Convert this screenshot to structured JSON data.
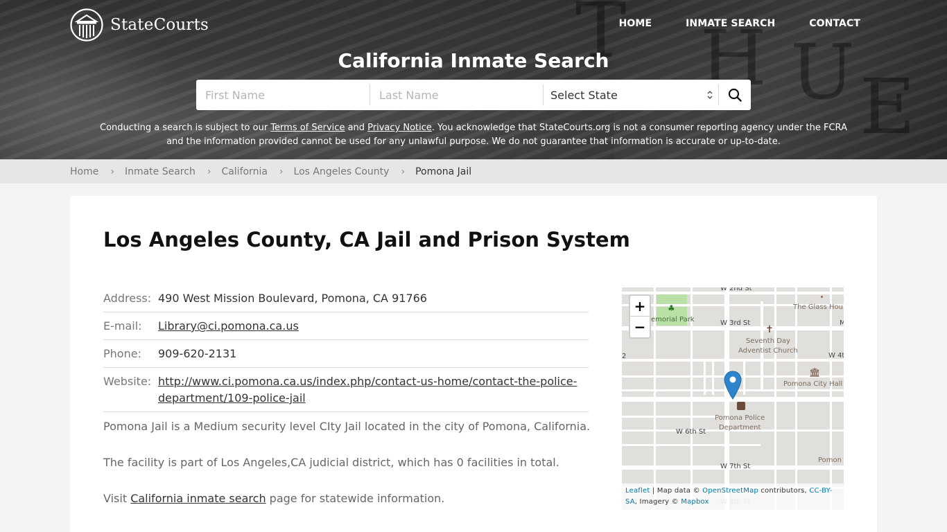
{
  "site": {
    "logo_text": "StateCourts",
    "nav": [
      {
        "label": "HOME"
      },
      {
        "label": "INMATE SEARCH"
      },
      {
        "label": "CONTACT"
      }
    ]
  },
  "hero": {
    "title": "California Inmate Search",
    "search": {
      "first_name_placeholder": "First Name",
      "last_name_placeholder": "Last Name",
      "state_select_value": "Select State",
      "search_icon": "search-icon"
    },
    "disclaimer": {
      "prefix": "Conducting a search is subject to our ",
      "terms_link": "Terms of Service",
      "and": " and ",
      "privacy_link": "Privacy Notice",
      "suffix": ". You acknowledge that StateCourts.org is not a consumer reporting agency under the FCRA and the information provided cannot be used for any unlawful purpose. We do not guarantee that information is accurate or up-to-date."
    }
  },
  "breadcrumb": [
    {
      "label": "Home"
    },
    {
      "label": "Inmate Search"
    },
    {
      "label": "California"
    },
    {
      "label": "Los Angeles County"
    },
    {
      "label": "Pomona Jail"
    }
  ],
  "main": {
    "title": "Los Angeles County, CA Jail and Prison System",
    "info": {
      "address_label": "Address:",
      "address_value": "490 West Mission Boulevard, Pomona, CA 91766",
      "email_label": "E-mail:",
      "email_value": "Library@ci.pomona.ca.us",
      "phone_label": "Phone:",
      "phone_value": "909-620-2131",
      "website_label": "Website:",
      "website_value": "http://www.ci.pomona.ca.us/index.php/contact-us-home/contact-the-police-department/109-police-jail"
    },
    "paragraphs": {
      "p1": "Pomona Jail is a Medium security level CIty Jail located in the city of Pomona, California.",
      "p2": "The facility is part of Los Angeles,CA judicial district, which has 0 facilities in total.",
      "p3_prefix": "Visit ",
      "p3_link": "California inmate search",
      "p3_suffix": " page for statewide information."
    }
  },
  "map": {
    "zoom_in": "+",
    "zoom_out": "−",
    "labels": {
      "w2nd": "W 2nd St",
      "w3rd": "W 3rd St",
      "w4th": "W 4t",
      "w6th": "W 6th St",
      "w7th": "W 7th St",
      "w8th": "W 8th St",
      "park": "emorial Park",
      "glass": "The Glass Hou",
      "church_line1": "Seventh Day",
      "church_line2": "Adventist Church",
      "cityhall": "Pomona City Hall",
      "police_line1": "Pomona Police",
      "police_line2": "Department",
      "pomon": "Pomon",
      "edge_m": "M",
      "edge_2": "2"
    },
    "attribution": {
      "leaflet": "Leaflet",
      "sep": " | Map data © ",
      "osm": "OpenStreetMap",
      "contrib": " contributors, ",
      "license": "CC-BY-SA",
      "imagery": ", Imagery © ",
      "mapbox": "Mapbox"
    }
  }
}
